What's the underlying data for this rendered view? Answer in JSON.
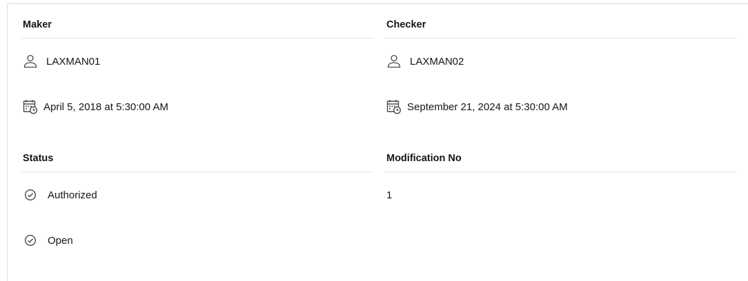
{
  "maker": {
    "heading": "Maker",
    "user": "LAXMAN01",
    "datetime": "April 5, 2018 at 5:30:00 AM"
  },
  "checker": {
    "heading": "Checker",
    "user": "LAXMAN02",
    "datetime": "September 21, 2024 at 5:30:00 AM"
  },
  "status": {
    "heading": "Status",
    "values": [
      "Authorized",
      "Open"
    ]
  },
  "modification": {
    "heading": "Modification No",
    "value": "1"
  },
  "icons": {
    "user": "user-icon",
    "calendar": "calendar-clock-icon",
    "status": "check-circle-icon"
  }
}
